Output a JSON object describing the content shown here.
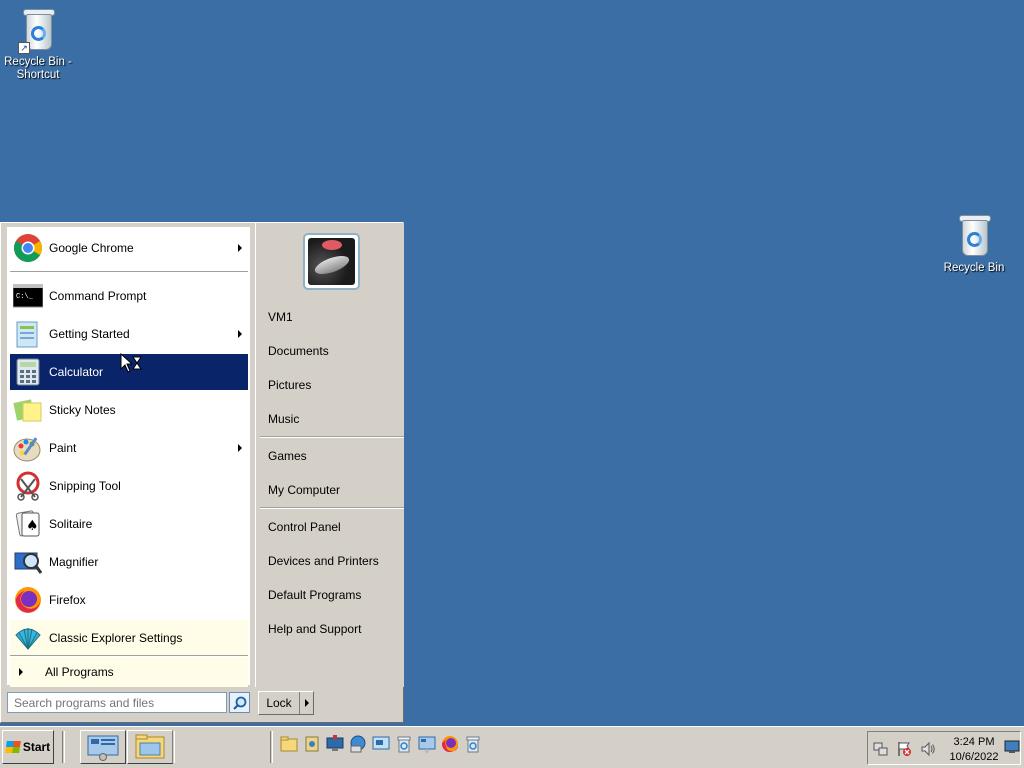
{
  "desktop": {
    "icons": [
      {
        "label": "Recycle Bin - Shortcut"
      },
      {
        "label": "Recycle Bin"
      }
    ]
  },
  "start_menu": {
    "programs": [
      {
        "label": "Google Chrome",
        "icon": "chrome-icon",
        "has_submenu": true
      },
      {
        "label": "Command Prompt",
        "icon": "command-prompt-icon",
        "has_submenu": false
      },
      {
        "label": "Getting Started",
        "icon": "getting-started-icon",
        "has_submenu": true
      },
      {
        "label": "Calculator",
        "icon": "calculator-icon",
        "has_submenu": false,
        "selected": true
      },
      {
        "label": "Sticky Notes",
        "icon": "sticky-notes-icon",
        "has_submenu": false
      },
      {
        "label": "Paint",
        "icon": "paint-icon",
        "has_submenu": true
      },
      {
        "label": "Snipping Tool",
        "icon": "snipping-tool-icon",
        "has_submenu": false
      },
      {
        "label": "Solitaire",
        "icon": "solitaire-icon",
        "has_submenu": false
      },
      {
        "label": "Magnifier",
        "icon": "magnifier-icon",
        "has_submenu": false
      },
      {
        "label": "Firefox",
        "icon": "firefox-icon",
        "has_submenu": false
      },
      {
        "label": "Classic Explorer Settings",
        "icon": "classic-shell-icon",
        "has_submenu": false,
        "highlighted": true
      }
    ],
    "all_programs": "All Programs",
    "right_items": [
      {
        "label": "VM1"
      },
      {
        "label": "Documents"
      },
      {
        "label": "Pictures"
      },
      {
        "label": "Music"
      },
      {
        "label": "Games"
      },
      {
        "label": "My Computer"
      },
      {
        "label": "Control Panel"
      },
      {
        "label": "Devices and Printers"
      },
      {
        "label": "Default Programs"
      },
      {
        "label": "Help and Support"
      }
    ],
    "search_placeholder": "Search programs and files",
    "lock_label": "Lock"
  },
  "taskbar": {
    "start_label": "Start",
    "clock_time": "3:24 PM",
    "clock_date": "10/6/2022"
  },
  "colors": {
    "desktop": "#3a6ea5",
    "selection": "#0a246a",
    "face": "#d4d0c8"
  }
}
